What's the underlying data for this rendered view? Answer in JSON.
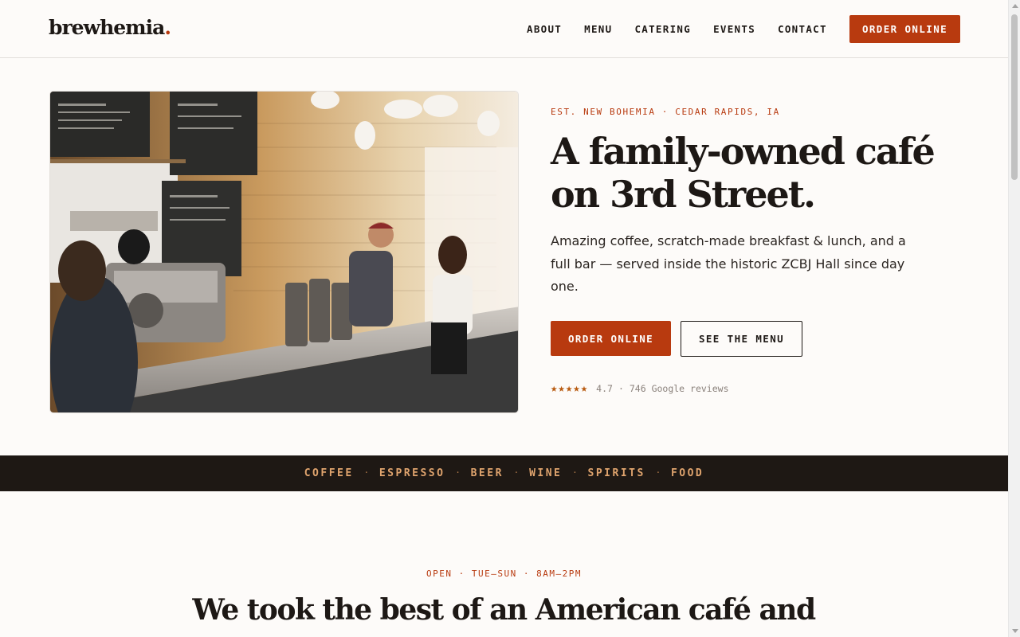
{
  "brand": {
    "name": "brewhemia",
    "dot": "."
  },
  "nav": {
    "items": [
      "ABOUT",
      "MENU",
      "CATERING",
      "EVENTS",
      "CONTACT"
    ],
    "order_label": "ORDER ONLINE"
  },
  "hero": {
    "kicker": "EST. NEW BOHEMIA · CEDAR RAPIDS, IA",
    "title_line1": "A family-owned café",
    "title_line2": "on 3rd Street.",
    "body": "Amazing coffee, scratch-made breakfast & lunch, and a full bar — served inside the historic ZCBJ Hall since day one.",
    "primary_cta": "ORDER ONLINE",
    "secondary_cta": "SEE THE MENU",
    "rating": {
      "stars": "★★★★★",
      "score": "4.7",
      "reviews": "746 Google reviews",
      "separator": "·"
    },
    "photo_icon": "cafe-counter-photo"
  },
  "offerings": {
    "items": [
      "COFFEE",
      "ESPRESSO",
      "BEER",
      "WINE",
      "SPIRITS",
      "FOOD"
    ],
    "separator": "·"
  },
  "intro": {
    "hours": "OPEN · TUE–SUN · 8AM–2PM",
    "title": "We took the best of an American café and"
  },
  "colors": {
    "accent": "#b83a0f",
    "dark": "#1e1814",
    "background": "#fdfbf9",
    "band_text": "#e0a46e"
  }
}
